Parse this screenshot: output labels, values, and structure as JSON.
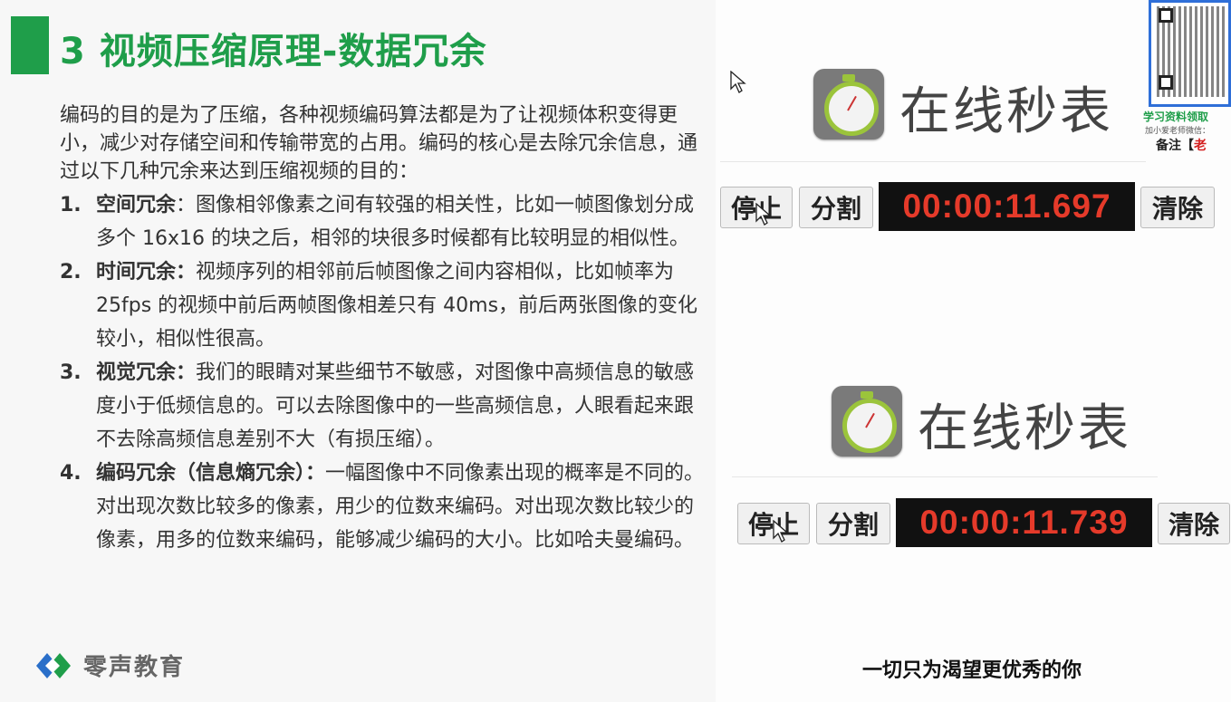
{
  "slide": {
    "title": "3 视频压缩原理-数据冗余",
    "intro": "编码的目的是为了压缩，各种视频编码算法都是为了让视频体积变得更小，减少对存储空间和传输带宽的占用。编码的核心是去除冗余信息，通过以下几种冗余来达到压缩视频的目的：",
    "items": [
      {
        "num": "1.",
        "term": "空间冗余",
        "text": "：图像相邻像素之间有较强的相关性，比如一帧图像划分成多个 16x16 的块之后，相邻的块很多时候都有比较明显的相似性。"
      },
      {
        "num": "2.",
        "term": "时间冗余：",
        "text": "视频序列的相邻前后帧图像之间内容相似，比如帧率为 25fps 的视频中前后两帧图像相差只有 40ms，前后两张图像的变化较小，相似性很高。"
      },
      {
        "num": "3.",
        "term": "视觉冗余：",
        "text": "我们的眼睛对某些细节不敏感，对图像中高频信息的敏感度小于低频信息的。可以去除图像中的一些高频信息，人眼看起来跟不去除高频信息差别不大（有损压缩）。"
      },
      {
        "num": "4.",
        "term": "编码冗余（信息熵冗余）：",
        "text": "一幅图像中不同像素出现的概率是不同的。对出现次数比较多的像素，用少的位数来编码。对出现次数比较少的像素，用多的位数来编码，能够减少编码的大小。比如哈夫曼编码。"
      }
    ],
    "logo_text": "零声教育"
  },
  "qr": {
    "caption": "学习资料领取",
    "sub": "加小爱老师微信：",
    "note_prefix": "备注【",
    "note_highlight": "老"
  },
  "stopwatches": [
    {
      "title": "在线秒表",
      "stop_label": "停止",
      "split_label": "分割",
      "time": "00:00:11.697",
      "clear_label": "清除"
    },
    {
      "title": "在线秒表",
      "stop_label": "停止",
      "split_label": "分割",
      "time": "00:00:11.739",
      "clear_label": "清除"
    }
  ],
  "slogan": "一切只为渴望更优秀的你",
  "colors": {
    "accent": "#1f9e4a",
    "timer": "#e53a2a",
    "qr_border": "#2f6fd8"
  }
}
